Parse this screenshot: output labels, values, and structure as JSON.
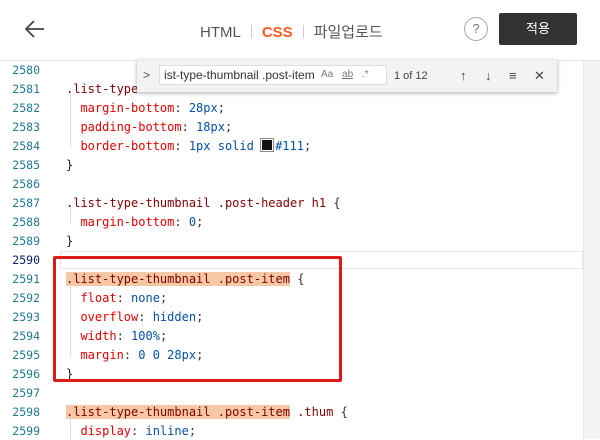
{
  "header": {
    "tabs": [
      "HTML",
      "CSS",
      "파일업로드"
    ],
    "active_tab": "CSS",
    "help_label": "?",
    "apply_label": "적용"
  },
  "find": {
    "toggle": ">",
    "query": "ist-type-thumbnail .post-item",
    "opt_case": "Aa",
    "opt_word": "ab",
    "opt_regex": ".*",
    "count": "1 of 12",
    "prev": "↑",
    "next": "↓",
    "in_selection": "≡",
    "close": "✕"
  },
  "editor": {
    "current_line": "2590",
    "lines": [
      {
        "n": "2580",
        "code": ""
      },
      {
        "n": "2581",
        "code": ".list-type"
      },
      {
        "n": "2582",
        "code": "  margin-bottom: 28px;"
      },
      {
        "n": "2583",
        "code": "  padding-bottom: 18px;"
      },
      {
        "n": "2584",
        "code": "  border-bottom: 1px solid #111;"
      },
      {
        "n": "2585",
        "code": "}"
      },
      {
        "n": "2586",
        "code": ""
      },
      {
        "n": "2587",
        "code": ".list-type-thumbnail .post-header h1 {"
      },
      {
        "n": "2588",
        "code": "  margin-bottom: 0;"
      },
      {
        "n": "2589",
        "code": "}"
      },
      {
        "n": "2590",
        "code": ""
      },
      {
        "n": "2591",
        "code": ".list-type-thumbnail .post-item {"
      },
      {
        "n": "2592",
        "code": "  float: none;"
      },
      {
        "n": "2593",
        "code": "  overflow: hidden;"
      },
      {
        "n": "2594",
        "code": "  width: 100%;"
      },
      {
        "n": "2595",
        "code": "  margin: 0 0 28px;"
      },
      {
        "n": "2596",
        "code": "}"
      },
      {
        "n": "2597",
        "code": ""
      },
      {
        "n": "2598",
        "code": ".list-type-thumbnail .post-item .thum {"
      },
      {
        "n": "2599",
        "code": "  display: inline;"
      }
    ]
  },
  "colors": {
    "accent": "#ff5a1f",
    "selector": "#800000",
    "property": "#e50000",
    "value": "#0451a5",
    "match_highlight": "#f7c8a6",
    "annotation_box": "#e01919",
    "apply_button": "#333333"
  },
  "icons": {
    "back": "arrow-left-icon",
    "help": "question-circle-icon"
  }
}
